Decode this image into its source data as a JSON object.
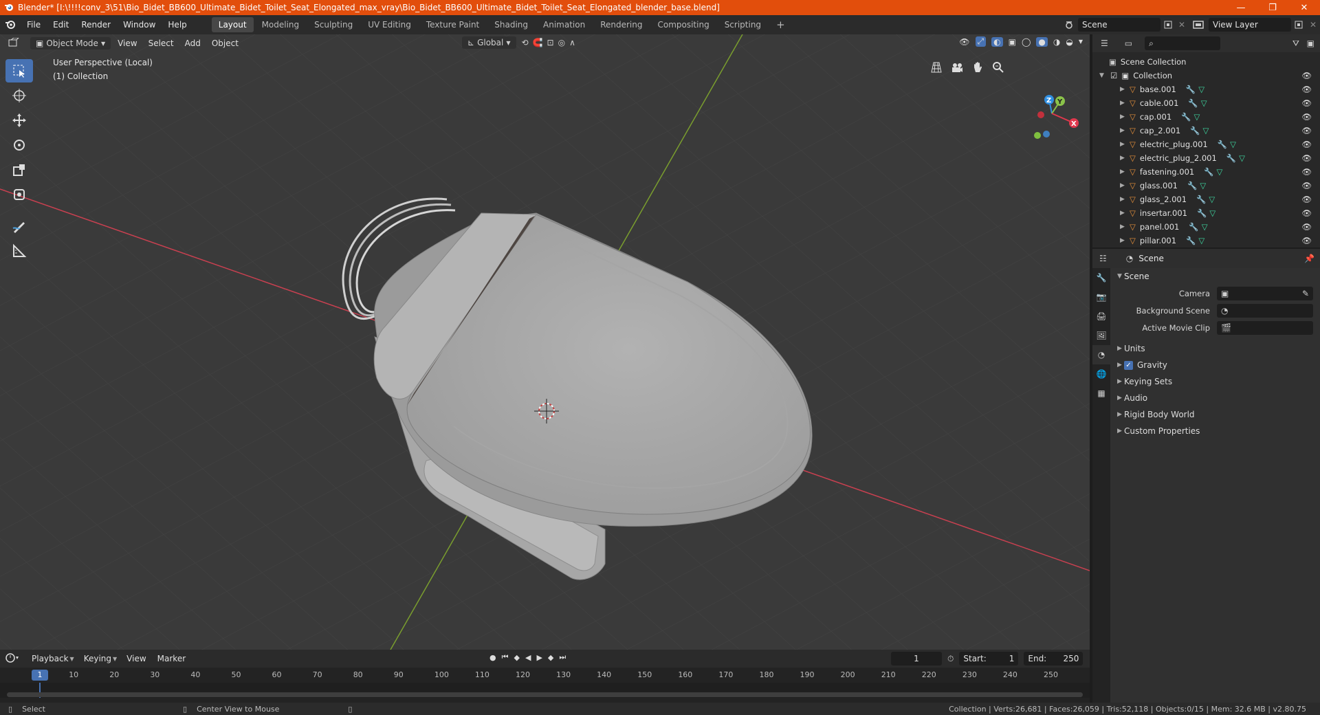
{
  "window": {
    "title": "Blender* [I:\\!!!!conv_3\\51\\Bio_Bidet_BB600_Ultimate_Bidet_Toilet_Seat_Elongated_max_vray\\Bio_Bidet_BB600_Ultimate_Bidet_Toilet_Seat_Elongated_blender_base.blend]",
    "minimize": "—",
    "maximize": "❐",
    "close": "✕"
  },
  "menu": [
    "File",
    "Edit",
    "Render",
    "Window",
    "Help"
  ],
  "workspaces": [
    {
      "label": "Layout",
      "active": true
    },
    {
      "label": "Modeling"
    },
    {
      "label": "Sculpting"
    },
    {
      "label": "UV Editing"
    },
    {
      "label": "Texture Paint"
    },
    {
      "label": "Shading"
    },
    {
      "label": "Animation"
    },
    {
      "label": "Rendering"
    },
    {
      "label": "Compositing"
    },
    {
      "label": "Scripting"
    }
  ],
  "add_workspace": "+",
  "scene_field": "Scene",
  "view_layer_field": "View Layer",
  "viewport": {
    "mode": "Object Mode",
    "menus": [
      "View",
      "Select",
      "Add",
      "Object"
    ],
    "orientation": "Global",
    "perspective_label": "User Perspective (Local)",
    "collection_label": "(1) Collection",
    "axes": {
      "x": "X",
      "y": "Y",
      "z": "Z"
    }
  },
  "timeline": {
    "menus": [
      "Playback",
      "Keying",
      "View",
      "Marker"
    ],
    "current_frame": "1",
    "start_label": "Start:",
    "start_value": "1",
    "end_label": "End:",
    "end_value": "250",
    "ruler": [
      "10",
      "20",
      "30",
      "40",
      "50",
      "60",
      "70",
      "80",
      "90",
      "100",
      "110",
      "120",
      "130",
      "140",
      "150",
      "160",
      "170",
      "180",
      "190",
      "200",
      "210",
      "220",
      "230",
      "240",
      "250"
    ],
    "playhead": "1"
  },
  "status": {
    "select": "Select",
    "center_view": "Center View to Mouse",
    "stats": "Collection | Verts:26,681 | Faces:26,059 | Tris:52,118 | Objects:0/15 | Mem: 32.6 MB | v2.80.75"
  },
  "outliner": {
    "root": "Scene Collection",
    "collection": "Collection",
    "items": [
      "base.001",
      "cable.001",
      "cap.001",
      "cap_2.001",
      "electric_plug.001",
      "electric_plug_2.001",
      "fastening.001",
      "glass.001",
      "glass_2.001",
      "insertar.001",
      "panel.001",
      "pillar.001"
    ]
  },
  "properties": {
    "header": "Scene",
    "panel": "Scene",
    "camera_label": "Camera",
    "bg_scene_label": "Background Scene",
    "movie_clip_label": "Active Movie Clip",
    "sub_panels": [
      "Units",
      "Gravity",
      "Keying Sets",
      "Audio",
      "Rigid Body World",
      "Custom Properties"
    ]
  },
  "colors": {
    "title_bar": "#e24e0c",
    "accent": "#4772b3",
    "x_axis": "#e0384d",
    "y_axis": "#8bc34a",
    "z_axis": "#2f8ee0",
    "mesh_icon": "#e6903a",
    "modifier_icon": "#5aa0e8",
    "data_icon": "#3ed6a0"
  }
}
